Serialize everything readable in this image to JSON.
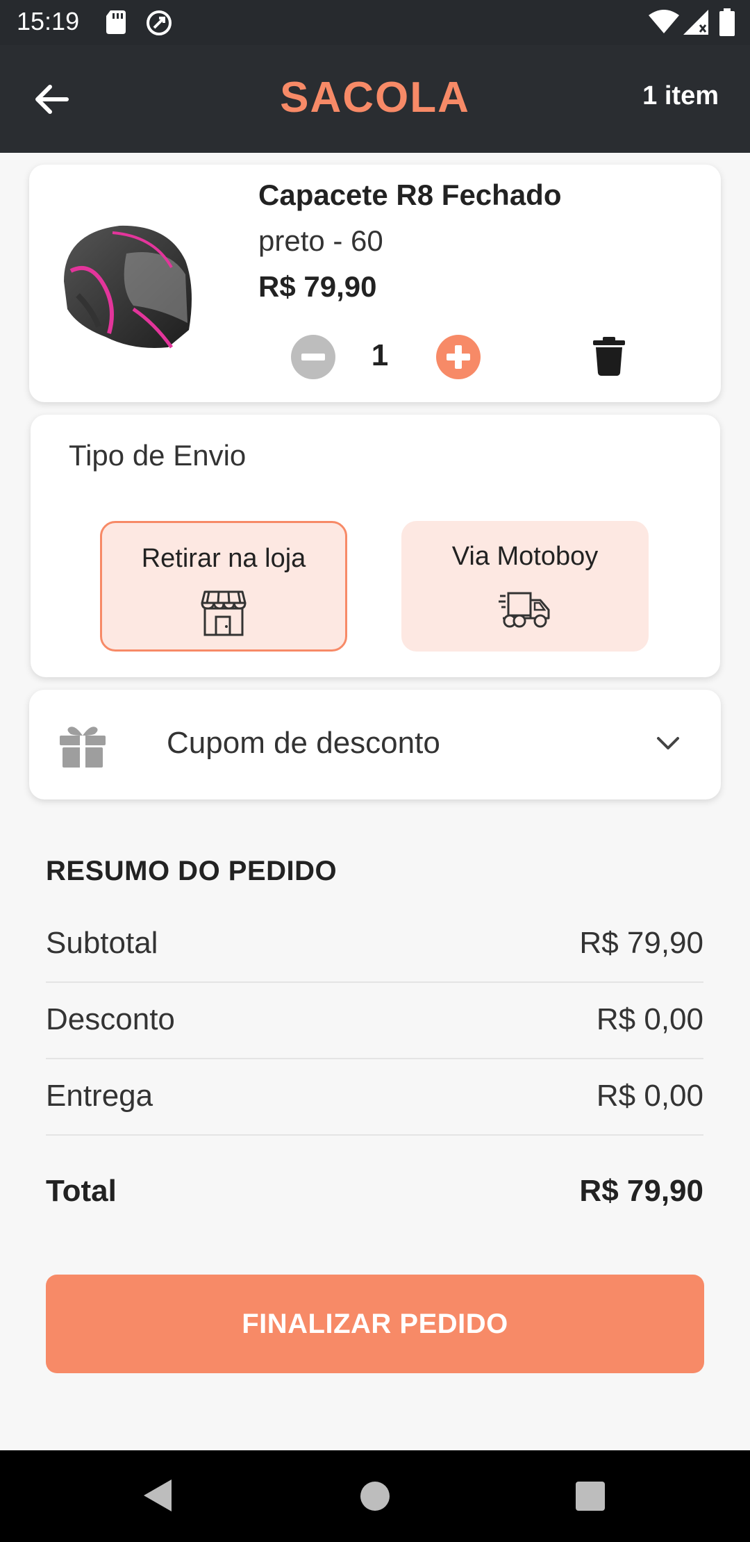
{
  "status_bar": {
    "time": "15:19"
  },
  "header": {
    "title": "SACOLA",
    "item_count": "1 item"
  },
  "cart": {
    "items": [
      {
        "name": "Capacete R8 Fechado",
        "variant": "preto - 60",
        "price": "R$ 79,90",
        "quantity": "1"
      }
    ]
  },
  "shipping": {
    "title": "Tipo de Envio",
    "options": [
      {
        "label": "Retirar na loja",
        "icon": "storefront-icon",
        "selected": true
      },
      {
        "label": "Via Motoboy",
        "icon": "delivery-truck-icon",
        "selected": false
      }
    ]
  },
  "coupon": {
    "label": "Cupom de desconto"
  },
  "summary": {
    "title": "RESUMO DO PEDIDO",
    "rows": [
      {
        "label": "Subtotal",
        "value": "R$ 79,90"
      },
      {
        "label": "Desconto",
        "value": "R$ 0,00"
      },
      {
        "label": "Entrega",
        "value": "R$ 0,00"
      }
    ],
    "total_label": "Total",
    "total_value": "R$ 79,90"
  },
  "actions": {
    "finalize_label": "FINALIZAR PEDIDO"
  },
  "colors": {
    "accent": "#f78a67",
    "header_bg": "#2a2d31",
    "option_bg": "#fde8e2"
  }
}
